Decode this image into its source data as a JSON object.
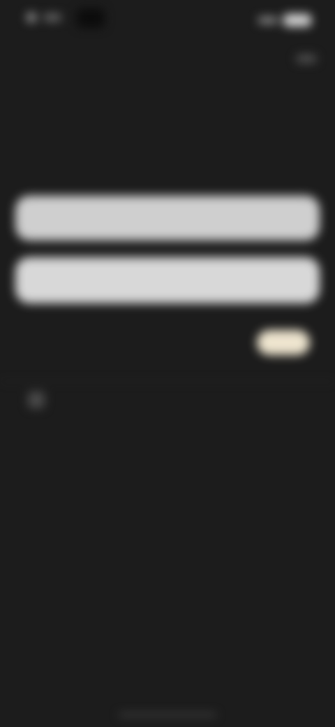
{
  "status_bar": {
    "time": "",
    "icons": [
      "signal-icon",
      "wifi-icon",
      "battery-icon"
    ]
  },
  "header": {
    "title": "",
    "subtitle": ""
  },
  "buttons": {
    "primary_label": "",
    "secondary_label": ""
  },
  "preference": {
    "label": "",
    "toggle_on": true,
    "accent_color": "#eee5cf"
  },
  "sub_row": {
    "label": ""
  },
  "footer": {
    "text": "",
    "link": ""
  },
  "colors": {
    "background": "#1c1c1c",
    "button": "#cfcfcf",
    "accent": "#b59a5c"
  }
}
